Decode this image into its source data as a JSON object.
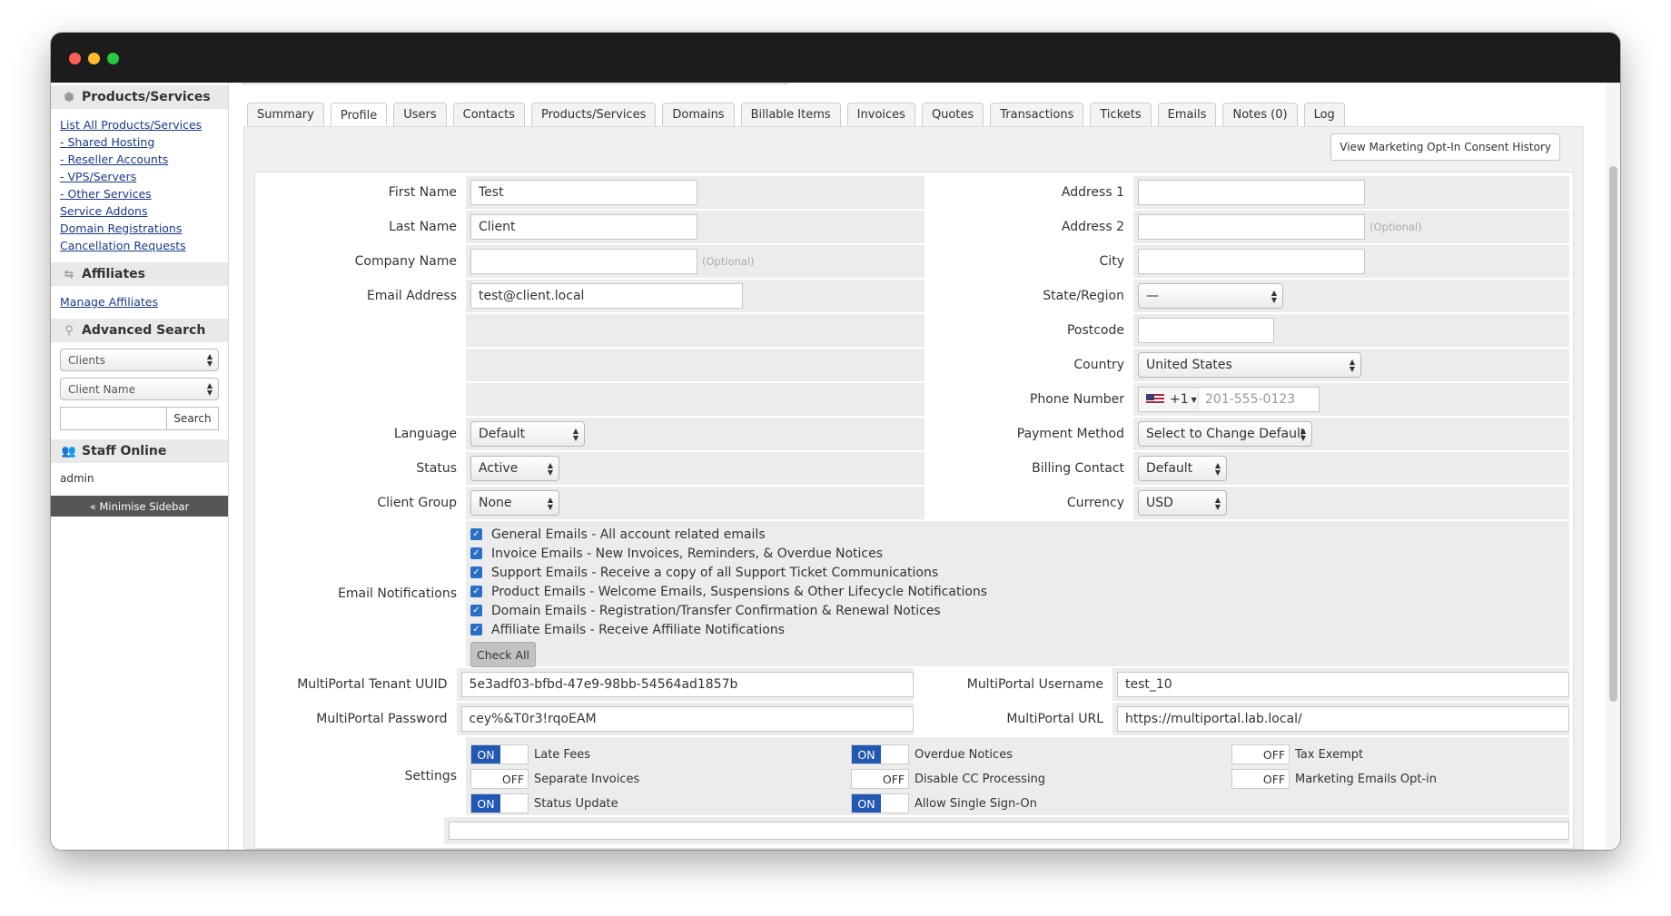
{
  "sidebar": {
    "products_title": "Products/Services",
    "product_links": [
      "List All Products/Services",
      "- Shared Hosting",
      "- Reseller Accounts",
      "- VPS/Servers",
      "- Other Services",
      "Service Addons",
      "Domain Registrations",
      "Cancellation Requests"
    ],
    "affiliates_title": "Affiliates",
    "manage_affiliates": "Manage Affiliates",
    "advanced_search_title": "Advanced Search",
    "search_type": "Clients",
    "search_field": "Client Name",
    "search_button": "Search",
    "staff_online_title": "Staff Online",
    "staff_user": "admin",
    "minimise": "« Minimise Sidebar"
  },
  "tabs": [
    "Summary",
    "Profile",
    "Users",
    "Contacts",
    "Products/Services",
    "Domains",
    "Billable Items",
    "Invoices",
    "Quotes",
    "Transactions",
    "Tickets",
    "Emails",
    "Notes (0)",
    "Log"
  ],
  "active_tab": "Profile",
  "consent_button": "View Marketing Opt-In Consent History",
  "optional": "(Optional)",
  "form": {
    "first_name": {
      "label": "First Name",
      "value": "Test"
    },
    "last_name": {
      "label": "Last Name",
      "value": "Client"
    },
    "company_name": {
      "label": "Company Name",
      "value": ""
    },
    "email": {
      "label": "Email Address",
      "value": "test@client.local"
    },
    "language": {
      "label": "Language",
      "value": "Default"
    },
    "status": {
      "label": "Status",
      "value": "Active"
    },
    "client_group": {
      "label": "Client Group",
      "value": "None"
    },
    "address1": {
      "label": "Address 1",
      "value": ""
    },
    "address2": {
      "label": "Address 2",
      "value": ""
    },
    "city": {
      "label": "City",
      "value": ""
    },
    "state": {
      "label": "State/Region",
      "value": "—"
    },
    "postcode": {
      "label": "Postcode",
      "value": ""
    },
    "country": {
      "label": "Country",
      "value": "United States"
    },
    "phone": {
      "label": "Phone Number",
      "code": "+1",
      "placeholder": "201-555-0123"
    },
    "payment_method": {
      "label": "Payment Method",
      "value": "Select to Change Default"
    },
    "billing_contact": {
      "label": "Billing Contact",
      "value": "Default"
    },
    "currency": {
      "label": "Currency",
      "value": "USD"
    },
    "email_notifications": {
      "label": "Email Notifications",
      "items": [
        "General Emails - All account related emails",
        "Invoice Emails - New Invoices, Reminders, & Overdue Notices",
        "Support Emails - Receive a copy of all Support Ticket Communications",
        "Product Emails - Welcome Emails, Suspensions & Other Lifecycle Notifications",
        "Domain Emails - Registration/Transfer Confirmation & Renewal Notices",
        "Affiliate Emails - Receive Affiliate Notifications"
      ],
      "check_all": "Check All"
    },
    "mp_uuid": {
      "label": "MultiPortal Tenant UUID",
      "value": "5e3adf03-bfbd-47e9-98bb-54564ad1857b"
    },
    "mp_password": {
      "label": "MultiPortal Password",
      "value": "cey%&T0r3!rqoEAM"
    },
    "mp_username": {
      "label": "MultiPortal Username",
      "value": "test_10"
    },
    "mp_url": {
      "label": "MultiPortal URL",
      "value": "https://multiportal.lab.local/"
    },
    "settings": {
      "label": "Settings",
      "on": "ON",
      "off": "OFF",
      "toggles": [
        {
          "name": "Late Fees",
          "state": "ON"
        },
        {
          "name": "Overdue Notices",
          "state": "ON"
        },
        {
          "name": "Tax Exempt",
          "state": "OFF"
        },
        {
          "name": "Separate Invoices",
          "state": "OFF"
        },
        {
          "name": "Disable CC Processing",
          "state": "OFF"
        },
        {
          "name": "Marketing Emails Opt-in",
          "state": "OFF"
        },
        {
          "name": "Status Update",
          "state": "ON"
        },
        {
          "name": "Allow Single Sign-On",
          "state": "ON"
        }
      ]
    }
  }
}
